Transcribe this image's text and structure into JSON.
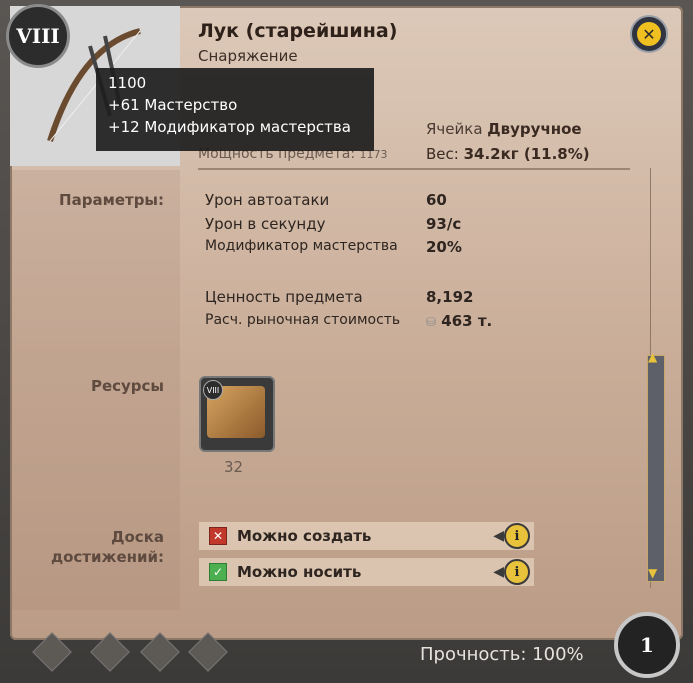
{
  "item": {
    "tier": "VIII",
    "name": "Лук (старейшина)",
    "category": "Снаряжение"
  },
  "tooltip": {
    "line1": "1100",
    "line2": "+61 Мастерство",
    "line3": "+12 Модификатор мастерства"
  },
  "header": {
    "power_label": "Мощность предмета:",
    "power_value": "1173",
    "slot_label": "Ячейка",
    "slot_value": "Двуручное",
    "weight_label": "Вес:",
    "weight_value": "34.2кг (11.8%)"
  },
  "sections": {
    "params": "Параметры:",
    "resources": "Ресурсы",
    "achievements": "Доска достижений:"
  },
  "stats": [
    {
      "name": "Урон автоатаки",
      "value": "60"
    },
    {
      "name": "Урон в секунду",
      "value": "93/с"
    },
    {
      "name": "Модификатор мастерства",
      "value": "20%"
    },
    {
      "name": "Ценность предмета",
      "value": "8,192"
    },
    {
      "name": "Расч. рыночная стоимость",
      "value": "463 т."
    }
  ],
  "resource": {
    "tier": "VIII",
    "count": "32"
  },
  "achievements": [
    {
      "label": "Можно создать",
      "status": "no"
    },
    {
      "label": "Можно носить",
      "status": "yes"
    }
  ],
  "footer": {
    "durability": "Прочность: 100%",
    "stack_count": "1"
  },
  "icons": {
    "close": "close-icon",
    "info": "info-icon",
    "coin": "silver-coin-icon"
  },
  "colors": {
    "panel_bg": "#d4bba8",
    "tooltip_bg": "#1e1e1e",
    "accent_gold": "#e8c23a",
    "cross_red": "#c0392b",
    "check_green": "#4caf50"
  }
}
